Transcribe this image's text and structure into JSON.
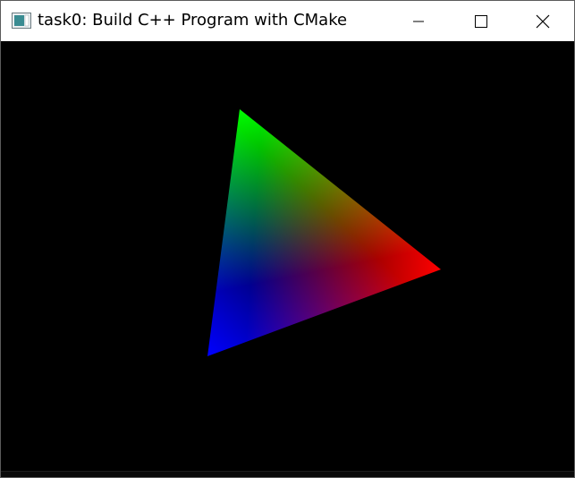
{
  "window": {
    "title": "task0: Build C++ Program with CMake",
    "app_icon": "app-window-icon",
    "controls": {
      "minimize_icon": "minimize-icon",
      "maximize_icon": "maximize-icon",
      "close_icon": "close-icon"
    }
  },
  "scene": {
    "background": "#000000",
    "triangle": {
      "vertices": [
        {
          "name": "top",
          "color": "#00ff00"
        },
        {
          "name": "right",
          "color": "#ff0000"
        },
        {
          "name": "bottom-left",
          "color": "#0000ff"
        }
      ]
    }
  }
}
